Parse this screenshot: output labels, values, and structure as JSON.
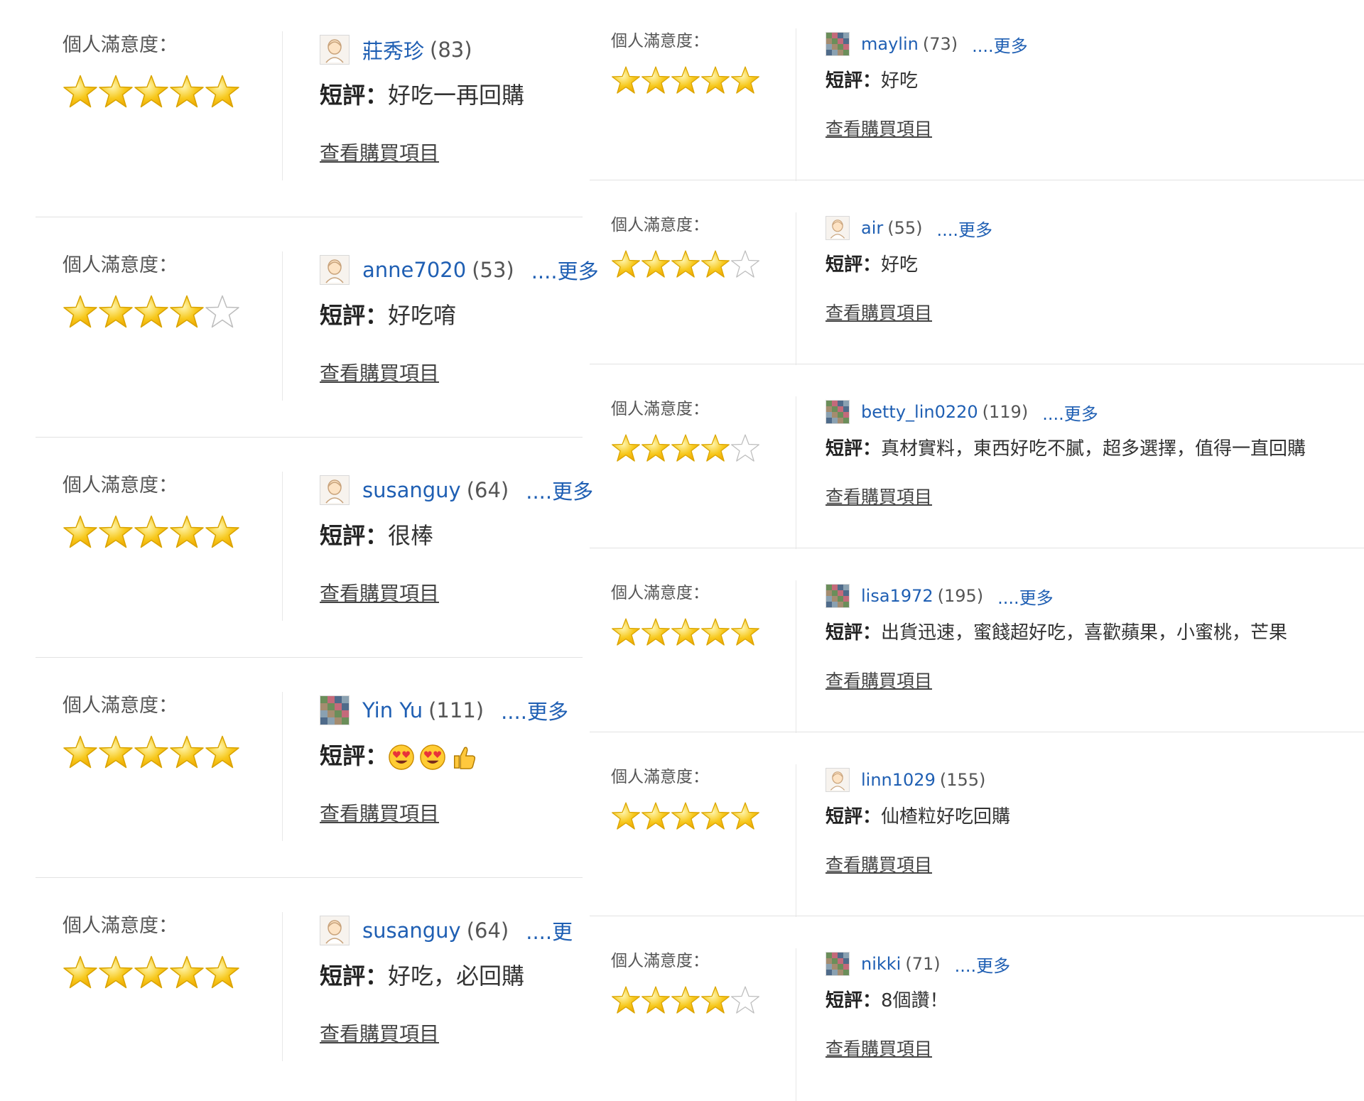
{
  "labels": {
    "satisfaction": "個人滿意度：",
    "comment": "短評：",
    "view_purchase": "查看購買項目"
  },
  "left_reviews": [
    {
      "username": "莊秀珍",
      "count": "(83)",
      "more": "",
      "rating": 5,
      "comment": "好吃一再回購",
      "avatar": "default-avatar"
    },
    {
      "username": "anne7020",
      "count": "(53)",
      "more": "....更多",
      "rating": 4,
      "comment": "好吃唷",
      "avatar": "default-avatar"
    },
    {
      "username": "susanguy",
      "count": "(64)",
      "more": "....更多",
      "rating": 5,
      "comment": "很棒",
      "avatar": "default-avatar"
    },
    {
      "username": "Yin Yu",
      "count": "(111)",
      "more": "....更多",
      "rating": 5,
      "comment": "",
      "emojis": [
        "smiling-face-with-heart-eyes",
        "smiling-face-with-heart-eyes",
        "thumbs-up"
      ],
      "avatar": "photo-avatar"
    },
    {
      "username": "susanguy",
      "count": "(64)",
      "more": "....更",
      "rating": 5,
      "comment": "好吃，必回購",
      "avatar": "default-avatar"
    }
  ],
  "right_reviews": [
    {
      "username": "maylin",
      "count": "(73)",
      "more": "....更多",
      "rating": 5,
      "comment": "好吃",
      "avatar": "photo-avatar"
    },
    {
      "username": "air",
      "count": "(55)",
      "more": "....更多",
      "rating": 4,
      "comment": "好吃",
      "avatar": "default-avatar"
    },
    {
      "username": "betty_lin0220",
      "count": "(119)",
      "more": "....更多",
      "rating": 4,
      "comment": "真材實料，東西好吃不膩，超多選擇，值得一直回購",
      "avatar": "photo-avatar"
    },
    {
      "username": "lisa1972",
      "count": "(195)",
      "more": "....更多",
      "rating": 5,
      "comment": "出貨迅速，蜜餞超好吃，喜歡蘋果，小蜜桃，芒果",
      "avatar": "photo-avatar"
    },
    {
      "username": "linn1029",
      "count": "(155)",
      "more": "",
      "rating": 5,
      "comment": "仙楂粒好吃回購",
      "avatar": "default-avatar"
    },
    {
      "username": "nikki",
      "count": "(71)",
      "more": "....更多",
      "rating": 4,
      "comment": "8個讚！",
      "avatar": "photo-avatar"
    }
  ],
  "colors": {
    "star_fill": "#f7c91e",
    "star_stroke": "#d9a400",
    "star_empty_stroke": "#bdbdbd",
    "link_blue": "#1f5fb3"
  }
}
